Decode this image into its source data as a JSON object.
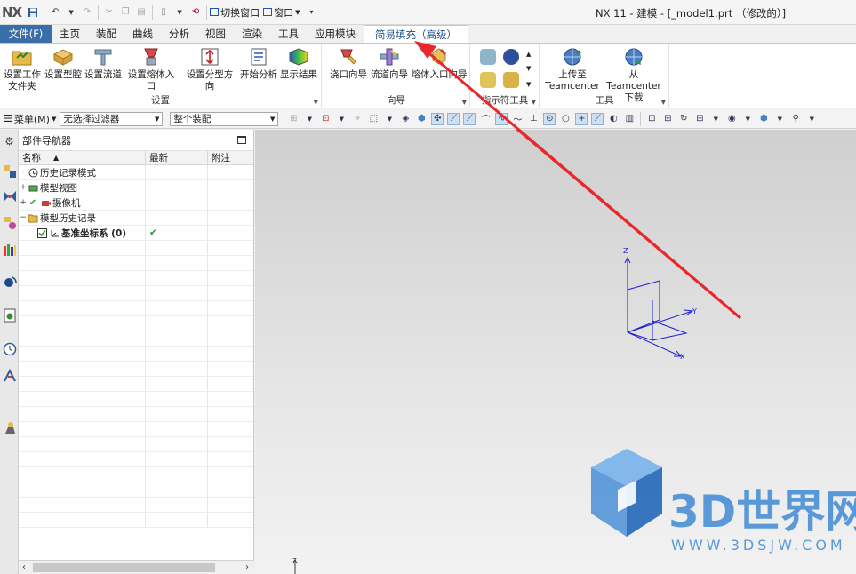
{
  "titlebar": {
    "logo": "NX",
    "switch_window_label": "切换窗口",
    "window_label": "窗口",
    "app_title": "NX 11 - 建模 - [_model1.prt （修改的）]"
  },
  "tabs": {
    "file": "文件(F)",
    "items": [
      "主页",
      "装配",
      "曲线",
      "分析",
      "视图",
      "渲染",
      "工具",
      "应用模块"
    ],
    "active": "简易填充（高级）"
  },
  "ribbon": {
    "group_setup": {
      "label": "设置",
      "buttons": [
        {
          "line1": "设置工作",
          "line2": "文件夹"
        },
        {
          "line1": "设置型腔",
          "line2": ""
        },
        {
          "line1": "设置流道",
          "line2": ""
        },
        {
          "line1": "设置熔体入口",
          "line2": ""
        },
        {
          "line1": "设置分型方向",
          "line2": ""
        },
        {
          "line1": "开始分析",
          "line2": ""
        },
        {
          "line1": "显示结果",
          "line2": ""
        }
      ]
    },
    "group_wizard": {
      "label": "向导",
      "buttons": [
        "浇口向导",
        "流道向导",
        "熔体入口向导"
      ]
    },
    "group_indicator": {
      "label": "指示符工具"
    },
    "group_tools": {
      "label": "工具",
      "buttons": [
        {
          "line1": "上传至",
          "line2": "Teamcenter"
        },
        {
          "line1": "从 Teamcenter",
          "line2": "下载"
        }
      ]
    }
  },
  "toolbar": {
    "menu_label": "菜单(M)",
    "filter_value": "无选择过滤器",
    "scope_value": "整个装配"
  },
  "navigator": {
    "title": "部件导航器",
    "columns": [
      "名称",
      "最新",
      "附注"
    ],
    "rows": [
      {
        "name": "历史记录模式",
        "latest": "",
        "note": ""
      },
      {
        "name": "模型视图",
        "latest": "",
        "note": ""
      },
      {
        "name": "摄像机",
        "latest": "",
        "note": ""
      },
      {
        "name": "模型历史记录",
        "latest": "",
        "note": ""
      },
      {
        "name": "基准坐标系 (0)",
        "latest": "✔",
        "note": ""
      }
    ]
  },
  "viewport": {
    "axis_labels": {
      "z": "Z",
      "y": "Y",
      "x": "X"
    },
    "watermark_title": "3D世界网",
    "watermark_url": "WWW.3DSJW.COM"
  },
  "colors": {
    "file_tab": "#3a6ea8",
    "axis_blue": "#1c1ccf",
    "arrow_red": "#e8282b",
    "watermark_blue": "#4a8fd6"
  }
}
